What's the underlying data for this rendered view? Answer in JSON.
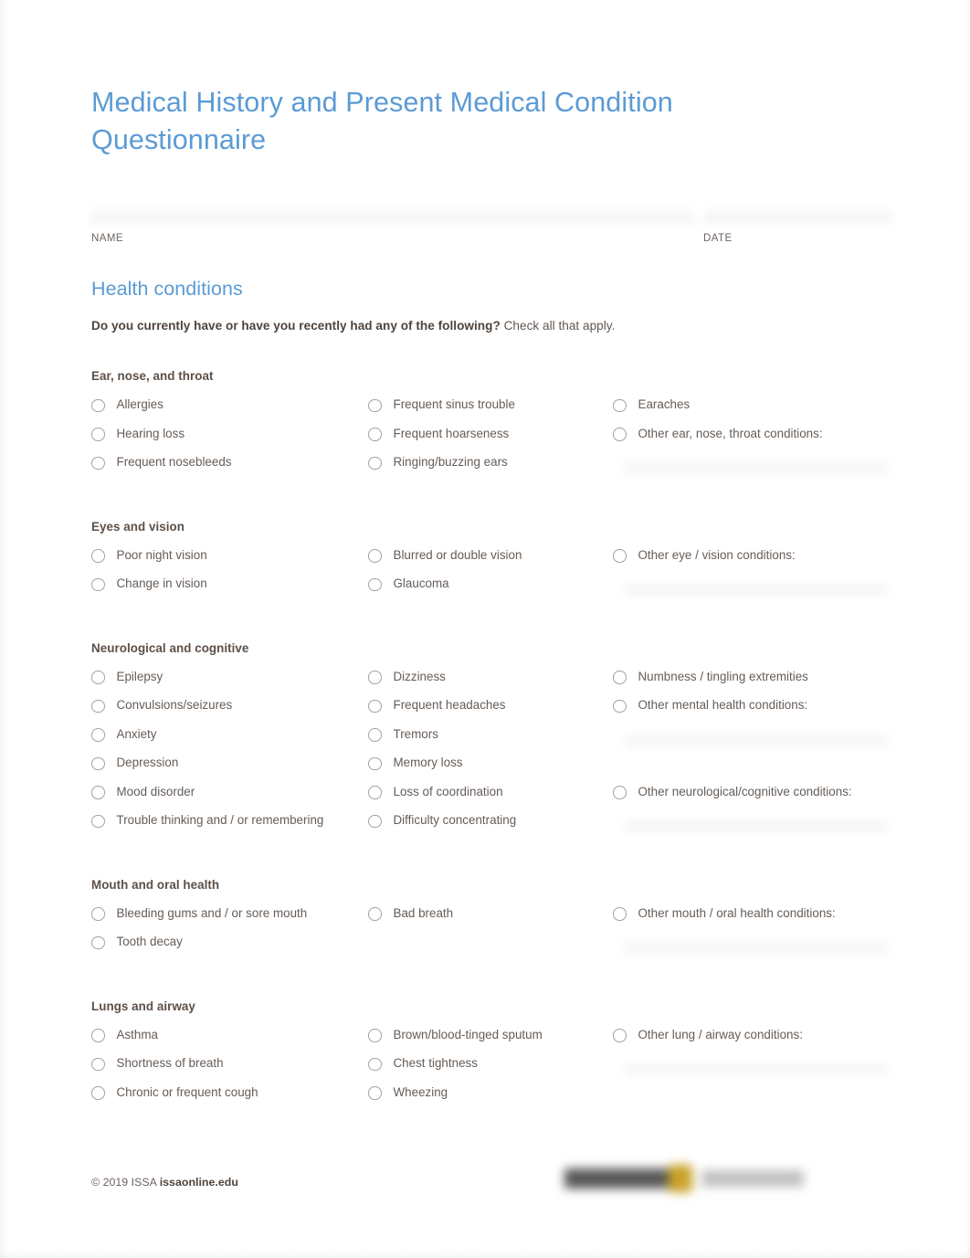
{
  "document": {
    "title": "Medical History and Present Medical Condition Questionnaire"
  },
  "identity": {
    "name_label": "NAME",
    "date_label": "DATE"
  },
  "health_conditions": {
    "section_title": "Health conditions",
    "instruction_bold": "Do you currently have or have you recently had any of the following?",
    "instruction_rest": "Check all that apply.",
    "groups": [
      {
        "heading": "Ear, nose, and throat",
        "col1": [
          "Allergies",
          "Hearing loss",
          "Frequent nosebleeds"
        ],
        "col2": [
          "Frequent sinus trouble",
          "Frequent hoarseness",
          "Ringing/buzzing ears"
        ],
        "col3": [
          "Earaches",
          "Other ear, nose, throat conditions:"
        ]
      },
      {
        "heading": "Eyes and vision",
        "col1": [
          "Poor night vision",
          "Change in vision"
        ],
        "col2": [
          "Blurred or double vision",
          "Glaucoma"
        ],
        "col3": [
          "Other eye / vision conditions:"
        ]
      },
      {
        "heading": "Neurological and cognitive",
        "col1": [
          "Epilepsy",
          "Convulsions/seizures",
          "Anxiety",
          "Depression",
          "Mood disorder",
          "Trouble thinking and / or remembering"
        ],
        "col2": [
          "Dizziness",
          "Frequent headaches",
          "Tremors",
          "Memory loss",
          "Loss of coordination",
          "Difficulty concentrating"
        ],
        "col3": [
          "Numbness / tingling extremities",
          "Other mental health conditions:",
          "Other neurological/cognitive conditions:"
        ]
      },
      {
        "heading": "Mouth and oral health",
        "col1": [
          "Bleeding gums and / or sore mouth",
          "Tooth decay"
        ],
        "col2": [
          "Bad breath"
        ],
        "col3": [
          "Other mouth / oral health conditions:"
        ]
      },
      {
        "heading": "Lungs and airway",
        "col1": [
          "Asthma",
          "Shortness of breath",
          "Chronic or frequent cough"
        ],
        "col2": [
          "Brown/blood-tinged sputum",
          "Chest tightness",
          "Wheezing"
        ],
        "col3": [
          "Other lung / airway conditions:"
        ]
      }
    ]
  },
  "footer": {
    "copyright_prefix": "© 2019 ISSA ",
    "website": "issaonline.edu"
  },
  "colors": {
    "heading_blue": "#5B9BD5",
    "body_text": "#665C56",
    "strong_text": "#5C5048",
    "circle_border": "#A9A19C"
  }
}
